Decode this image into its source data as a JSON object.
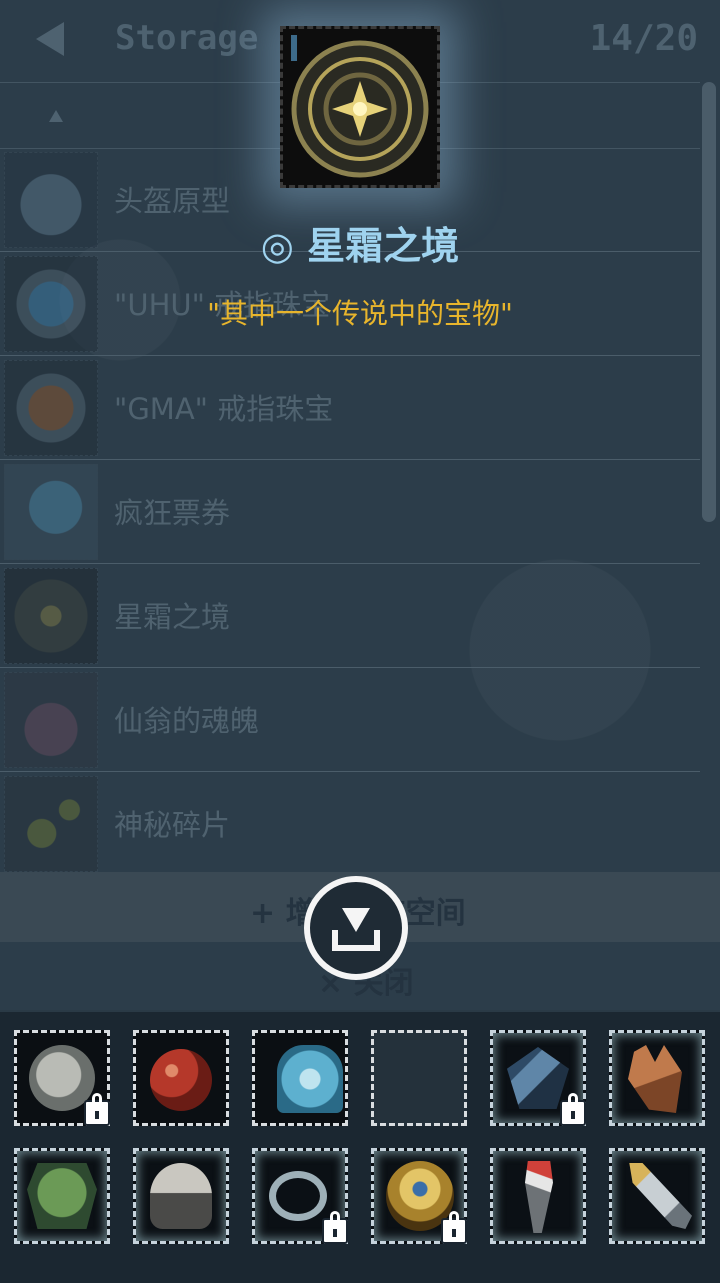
{
  "header": {
    "title": "Storage",
    "count": "14/20"
  },
  "list": [
    {
      "name": "头盔原型"
    },
    {
      "name": "\"UHU\" 戒指珠宝"
    },
    {
      "name": "\"GMA\" 戒指珠宝"
    },
    {
      "name": "疯狂票券"
    },
    {
      "name": "星霜之境"
    },
    {
      "name": "仙翁的魂魄"
    },
    {
      "name": "神秘碎片"
    }
  ],
  "expand_label": "+ 增加储存空间",
  "close_label": "× 关闭",
  "popup": {
    "name": "◎ 星霜之境",
    "description": "\"其中一个传说中的宝物\""
  },
  "colors": {
    "accent_name": "#9fd3ef",
    "accent_desc": "#e8b52c"
  },
  "inventory": [
    {
      "icon": "skull-helmet-icon",
      "locked": true
    },
    {
      "icon": "red-potion-icon",
      "locked": false
    },
    {
      "icon": "blue-potion-icon",
      "locked": false
    },
    {
      "icon": "empty-slot",
      "locked": false
    },
    {
      "icon": "spiked-armor-icon",
      "locked": true
    },
    {
      "icon": "glove-icon",
      "locked": false
    },
    {
      "icon": "green-armor-icon",
      "locked": false
    },
    {
      "icon": "helmet-icon",
      "locked": false
    },
    {
      "icon": "ring-icon",
      "locked": true
    },
    {
      "icon": "gold-amulet-icon",
      "locked": true
    },
    {
      "icon": "torch-icon",
      "locked": false
    },
    {
      "icon": "horn-icon",
      "locked": false
    }
  ]
}
